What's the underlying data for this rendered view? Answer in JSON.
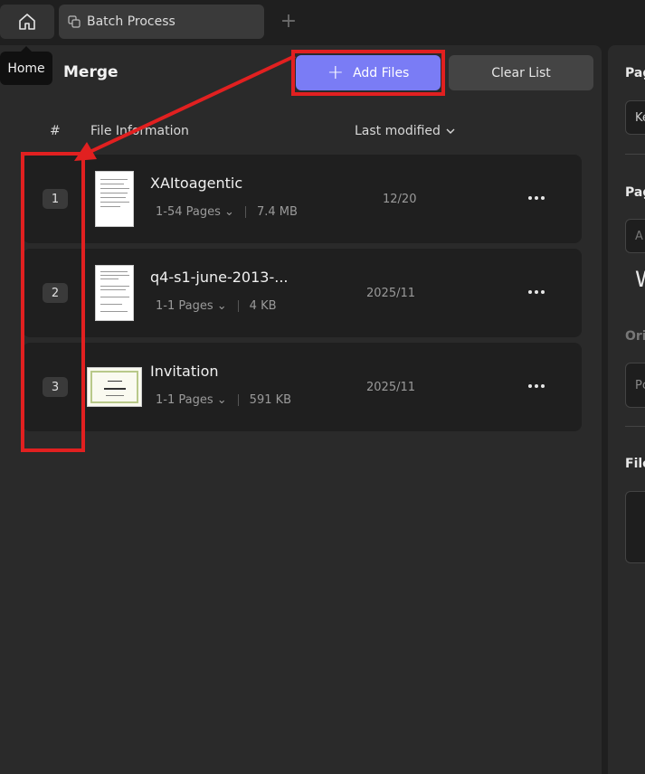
{
  "tabbar": {
    "home_tooltip": "Home",
    "tab_label": "Batch Process",
    "new_tab_symbol": "+"
  },
  "toolbar": {
    "title": "Merge",
    "add_files_label": "Add Files",
    "clear_list_label": "Clear List"
  },
  "columns": {
    "number": "#",
    "info": "File Information",
    "modified": "Last modified"
  },
  "files": [
    {
      "index": "1",
      "name": "XAItoagentic",
      "pages": "1-54 Pages",
      "size": "7.4 MB",
      "date": "12/20"
    },
    {
      "index": "2",
      "name": "q4-s1-june-2013-...",
      "pages": "1-1 Pages",
      "size": "4 KB",
      "date": "2025/11"
    },
    {
      "index": "3",
      "name": "Invitation",
      "pages": "1-1 Pages",
      "size": "591 KB",
      "date": "2025/11"
    }
  ],
  "right_panel": {
    "label1": "Pag",
    "box1": "Ke",
    "label2": "Pag",
    "box2": "A",
    "text_w": "W",
    "label3": "Ori",
    "box3": "Pc",
    "label4": "File"
  },
  "colors": {
    "accent": "#7a7cf5",
    "annotation": "#e12020"
  }
}
